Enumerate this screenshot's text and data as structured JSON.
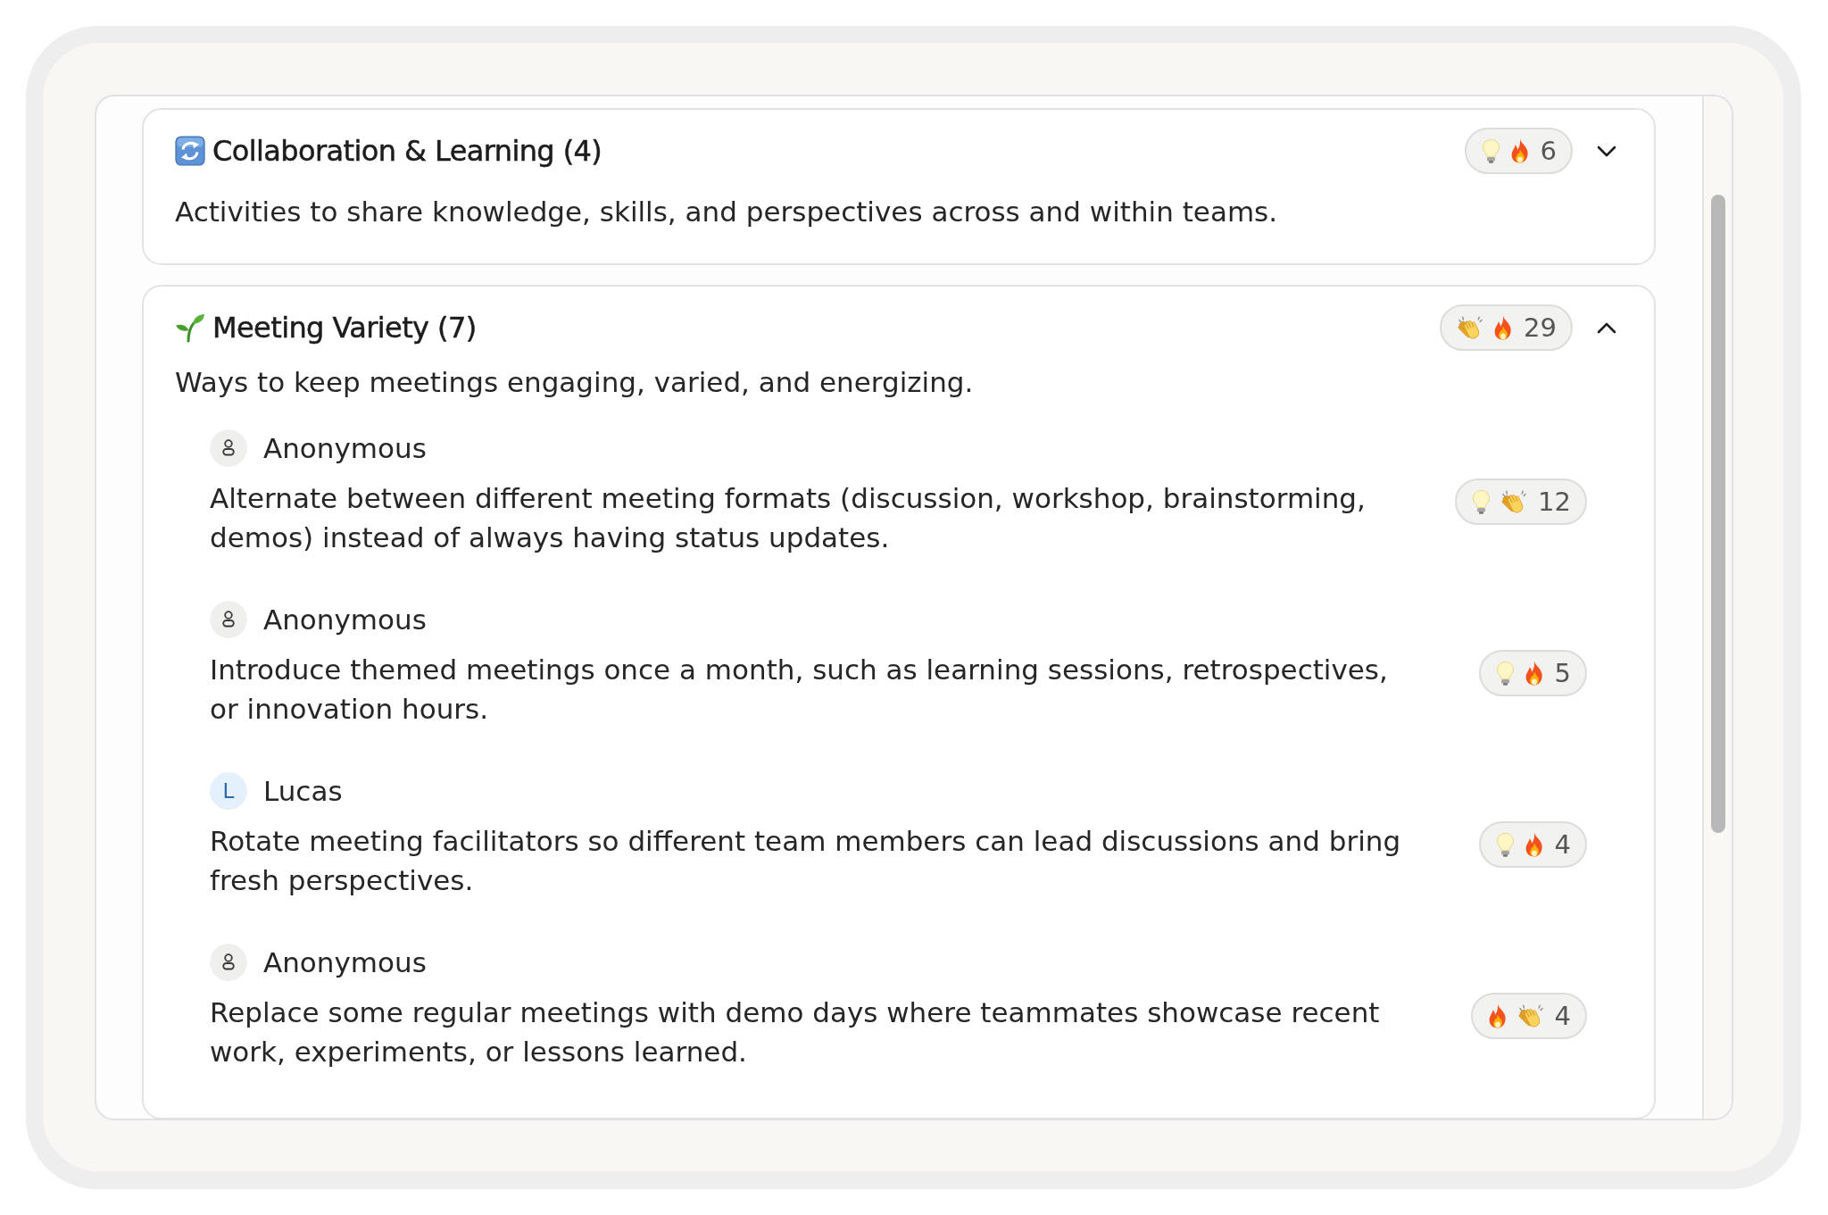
{
  "categories": [
    {
      "kind": "cycle",
      "title": "Collaboration & Learning (4)",
      "reaction_icons": [
        {
          "kind": "bulb"
        },
        {
          "kind": "fire"
        }
      ],
      "reaction_count": "6",
      "expanded": false,
      "description": "Activities to share knowledge, skills, and perspectives across and within teams."
    },
    {
      "kind": "sprout",
      "title": "Meeting Variety (7)",
      "reaction_icons": [
        {
          "kind": "clap"
        },
        {
          "kind": "fire"
        }
      ],
      "reaction_count": "29",
      "expanded": true,
      "description": "Ways to keep meetings engaging, varied, and energizing.",
      "comments": [
        {
          "author": {
            "kind": "anonymous",
            "name": "Anonymous"
          },
          "text": "Alternate between different meeting formats (discussion, workshop, brainstorming, demos) instead of always having status updates.",
          "reaction_icons": [
            {
              "kind": "bulb"
            },
            {
              "kind": "clap"
            }
          ],
          "reaction_count": "12"
        },
        {
          "author": {
            "kind": "anonymous",
            "name": "Anonymous"
          },
          "text": "Introduce themed meetings once a month, such as learning sessions, retrospectives, or innovation hours.",
          "reaction_icons": [
            {
              "kind": "bulb"
            },
            {
              "kind": "fire"
            }
          ],
          "reaction_count": "5"
        },
        {
          "author": {
            "kind": "initial",
            "initial": "L",
            "name": "Lucas"
          },
          "text": "Rotate meeting facilitators so different team members can lead discussions and bring fresh perspectives.",
          "reaction_icons": [
            {
              "kind": "bulb"
            },
            {
              "kind": "fire"
            }
          ],
          "reaction_count": "4"
        },
        {
          "author": {
            "kind": "anonymous",
            "name": "Anonymous"
          },
          "text": "Replace some regular meetings with demo days where teammates showcase recent work, experiments, or lessons learned.",
          "reaction_icons": [
            {
              "kind": "fire"
            },
            {
              "kind": "clap"
            }
          ],
          "reaction_count": "4"
        }
      ]
    }
  ]
}
